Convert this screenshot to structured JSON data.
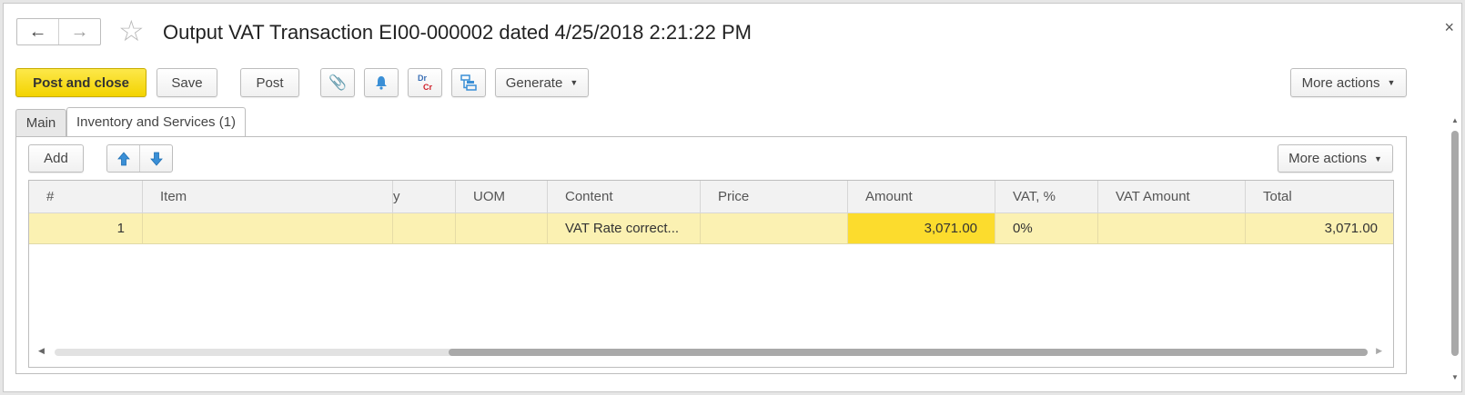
{
  "window": {
    "title": "Output VAT Transaction EI00-000002 dated 4/25/2018 2:21:22 PM",
    "back_icon": "←",
    "forward_icon": "→",
    "star_icon": "☆",
    "close_icon": "×"
  },
  "toolbar": {
    "post_and_close": "Post and close",
    "save": "Save",
    "post": "Post",
    "attach_icon": "paperclip-icon",
    "reminder_icon": "bell-icon",
    "dr": "Dr",
    "cr": "Cr",
    "structure_icon": "hierarchy-icon",
    "generate": "Generate",
    "more_actions": "More actions"
  },
  "tabs": [
    {
      "label": "Main",
      "active": false
    },
    {
      "label": "Inventory and Services (1)",
      "active": true
    }
  ],
  "table_toolbar": {
    "add": "Add",
    "move_up_icon": "⇧",
    "move_down_icon": "⇩",
    "more_actions": "More actions"
  },
  "table": {
    "columns": [
      "#",
      "Item",
      "y",
      "UOM",
      "Content",
      "Price",
      "Amount",
      "VAT, %",
      "VAT Amount",
      "Total"
    ],
    "rows": [
      {
        "num": "1",
        "item": "",
        "qty": "",
        "uom": "",
        "content": "VAT Rate correct...",
        "price": "",
        "amount": "3,071.00",
        "vat_rate": "0%",
        "vat_amount": "",
        "total": "3,071.00"
      }
    ]
  },
  "colors": {
    "primary_button": "#f3d300",
    "row_selected": "#fbf1b2",
    "amount_cell": "#fcdc2d"
  }
}
